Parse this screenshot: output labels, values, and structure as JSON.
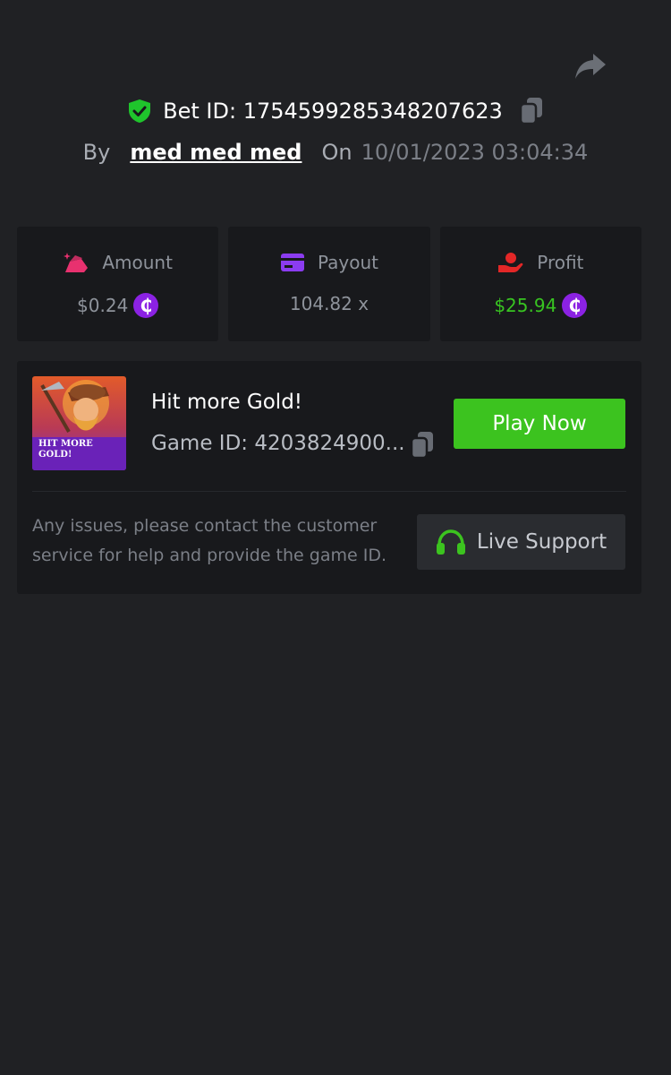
{
  "bet": {
    "id_text": "Bet ID: 1754599285348207623",
    "by_label": "By",
    "username": "med med med",
    "on_label": "On",
    "datetime": "10/01/2023 03:04:34"
  },
  "stats": {
    "amount": {
      "label": "Amount",
      "value": "$0.24",
      "currency_symbol": "₵"
    },
    "payout": {
      "label": "Payout",
      "value": "104.82 x"
    },
    "profit": {
      "label": "Profit",
      "value": "$25.94",
      "currency_symbol": "₵"
    }
  },
  "game": {
    "title": "Hit more Gold!",
    "id_text": "Game ID: 4203824900...",
    "thumbnail_text": [
      "HIT MORE",
      "GOLD!"
    ],
    "play_label": "Play Now",
    "help_text": "Any issues, please contact the customer service for help and provide the game ID.",
    "support_label": "Live Support"
  },
  "colors": {
    "background": "#202124",
    "card": "#18191c",
    "accent_green": "#3cc31f",
    "coin_purple": "#8b22e3",
    "amount_pink": "#e8316f",
    "payout_purple": "#8b3cf0",
    "profit_red": "#e32727"
  },
  "icons": [
    "share-icon",
    "shield-check-icon",
    "copy-icon",
    "amount-icon",
    "card-icon",
    "profit-hand-icon",
    "coin-icon",
    "headset-icon"
  ]
}
